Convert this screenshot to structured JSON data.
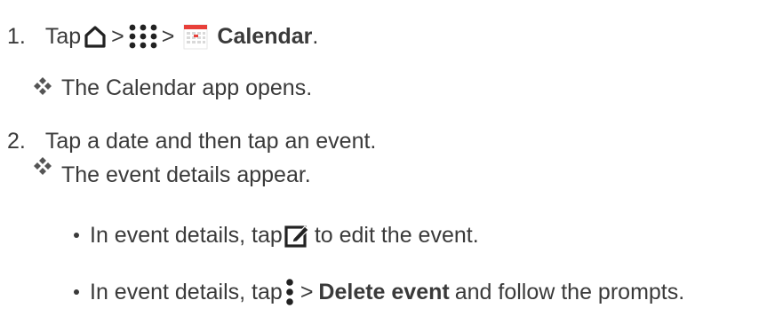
{
  "steps": [
    {
      "number": "1.",
      "text_before": "Tap",
      "sep1": ">",
      "sep2": ">",
      "app_label": "Calendar",
      "end": ".",
      "icons": [
        "home-icon",
        "apps-grid-icon",
        "calendar-icon"
      ],
      "result": "The Calendar app opens."
    },
    {
      "number": "2.",
      "text": "Tap a date and then tap an event.",
      "result": "The event details appear."
    }
  ],
  "bullets": [
    {
      "text_before": "In event details, tap",
      "icon": "edit-icon",
      "text_after": "to edit the event."
    },
    {
      "text_before": "In event details, tap",
      "icon": "more-options-icon",
      "sep": ">",
      "bold": "Delete event",
      "text_after": "and follow the prompts."
    }
  ],
  "colors": {
    "text": "#3a3a3a",
    "calendar_red": "#e8403a"
  }
}
